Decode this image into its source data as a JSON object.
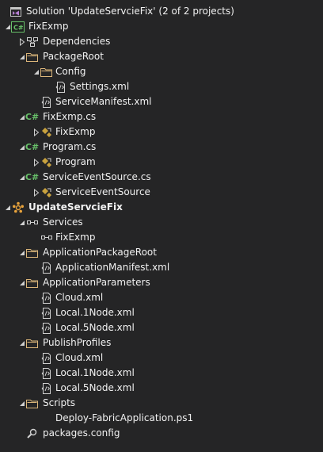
{
  "solution": {
    "label": "Solution 'UpdateServcieFix' (2 of 2 projects)",
    "icon": "solution-icon"
  },
  "rows": [
    {
      "label": "FixExmp",
      "icon": "csharp-project-icon",
      "arrow": "expanded"
    },
    {
      "label": "Dependencies",
      "icon": "dependencies-icon",
      "arrow": "collapsed"
    },
    {
      "label": "PackageRoot",
      "icon": "folder-icon",
      "arrow": "expanded"
    },
    {
      "label": "Config",
      "icon": "folder-icon",
      "arrow": "expanded"
    },
    {
      "label": "Settings.xml",
      "icon": "xml-file-icon",
      "arrow": "none"
    },
    {
      "label": "ServiceManifest.xml",
      "icon": "xml-file-icon",
      "arrow": "none"
    },
    {
      "label": "FixExmp.cs",
      "icon": "csharp-file-icon",
      "arrow": "expanded"
    },
    {
      "label": "FixExmp",
      "icon": "class-icon",
      "arrow": "collapsed-outline"
    },
    {
      "label": "Program.cs",
      "icon": "csharp-file-icon",
      "arrow": "expanded"
    },
    {
      "label": "Program",
      "icon": "class-icon",
      "arrow": "collapsed-outline"
    },
    {
      "label": "ServiceEventSource.cs",
      "icon": "csharp-file-icon",
      "arrow": "expanded"
    },
    {
      "label": "ServiceEventSource",
      "icon": "class-icon",
      "arrow": "collapsed-outline"
    },
    {
      "label": "UpdateServcieFix",
      "icon": "fabric-app-icon",
      "arrow": "expanded"
    },
    {
      "label": "Services",
      "icon": "services-icon",
      "arrow": "expanded"
    },
    {
      "label": "FixExmp",
      "icon": "service-ref-icon",
      "arrow": "none"
    },
    {
      "label": "ApplicationPackageRoot",
      "icon": "folder-icon",
      "arrow": "expanded"
    },
    {
      "label": "ApplicationManifest.xml",
      "icon": "xml-file-icon",
      "arrow": "none"
    },
    {
      "label": "ApplicationParameters",
      "icon": "folder-icon",
      "arrow": "expanded"
    },
    {
      "label": "Cloud.xml",
      "icon": "xml-file-icon",
      "arrow": "none"
    },
    {
      "label": "Local.1Node.xml",
      "icon": "xml-file-icon",
      "arrow": "none"
    },
    {
      "label": "Local.5Node.xml",
      "icon": "xml-file-icon",
      "arrow": "none"
    },
    {
      "label": "PublishProfiles",
      "icon": "folder-icon",
      "arrow": "expanded"
    },
    {
      "label": "Cloud.xml",
      "icon": "xml-file-icon",
      "arrow": "none"
    },
    {
      "label": "Local.1Node.xml",
      "icon": "xml-file-icon",
      "arrow": "none"
    },
    {
      "label": "Local.5Node.xml",
      "icon": "xml-file-icon",
      "arrow": "none"
    },
    {
      "label": "Scripts",
      "icon": "folder-icon",
      "arrow": "expanded"
    },
    {
      "label": "Deploy-FabricApplication.ps1",
      "icon": "powershell-file-icon",
      "arrow": "none"
    },
    {
      "label": "packages.config",
      "icon": "config-file-icon",
      "arrow": "none"
    }
  ],
  "colors": {
    "background": "#252526",
    "text": "#f1f1f1",
    "folder": "#dcb67a",
    "csharp": "#68c16a",
    "class": "#c9a23e",
    "solution": "#b67fd4",
    "fabric": "#e8a33c"
  }
}
